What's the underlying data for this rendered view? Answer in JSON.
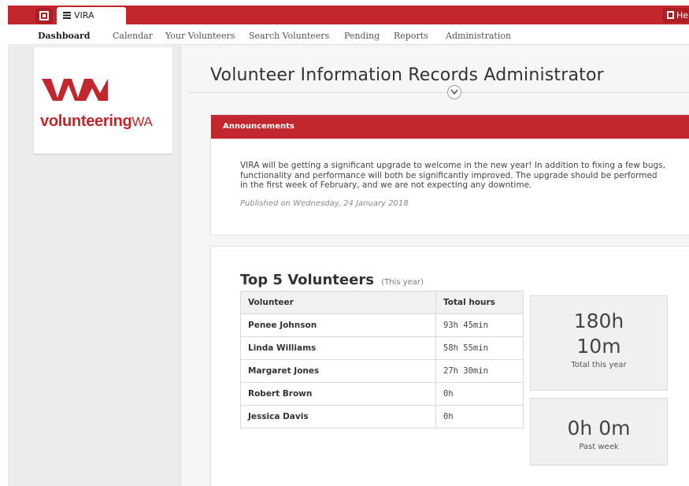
{
  "topbar": {
    "tab_label": "VIRA",
    "help_label": "Help"
  },
  "nav": {
    "items": [
      "Dashboard",
      "Calendar",
      "Your Volunteers",
      "Search Volunteers",
      "Pending",
      "Reports",
      "Administration"
    ]
  },
  "logo": {
    "wordmark": "volunteering",
    "suffix": "WA"
  },
  "page": {
    "title": "Volunteer Information Records Administrator"
  },
  "announcements": {
    "heading": "Announcements",
    "body": "VIRA will be getting a significant upgrade to welcome in the new year! In addition to fixing a few bugs, functionality and performance will both be significantly improved. The upgrade should be performed in the first week of February, and we are not expecting any downtime.",
    "published": "Published on Wednesday, 24 January 2018"
  },
  "top_volunteers": {
    "title": "Top 5 Volunteers",
    "subtitle": "(This year)",
    "columns": [
      "Volunteer",
      "Total hours"
    ],
    "rows": [
      {
        "name": "Penee Johnson",
        "hours": "93h 45min"
      },
      {
        "name": "Linda Williams",
        "hours": "58h 55min"
      },
      {
        "name": "Margaret Jones",
        "hours": "27h 30min"
      },
      {
        "name": "Robert Brown",
        "hours": "0h"
      },
      {
        "name": "Jessica Davis",
        "hours": "0h"
      }
    ]
  },
  "stats": {
    "year_value_line1": "180h",
    "year_value_line2": "10m",
    "year_label": "Total this year",
    "week_value": "0h 0m",
    "week_label": "Past week"
  },
  "colors": {
    "brand_red": "#c1272d"
  }
}
